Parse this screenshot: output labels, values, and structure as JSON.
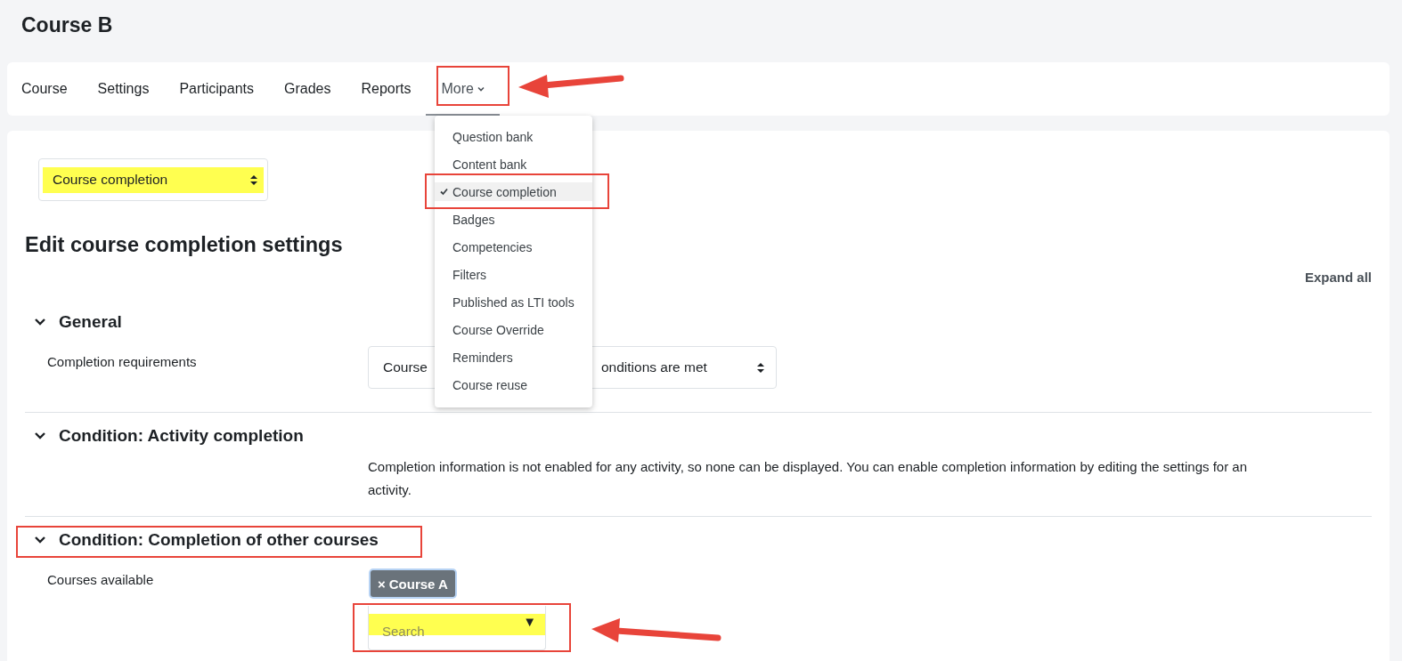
{
  "course_title": "Course B",
  "nav": {
    "tabs": [
      {
        "label": "Course",
        "selected": false
      },
      {
        "label": "Settings",
        "selected": false
      },
      {
        "label": "Participants",
        "selected": false
      },
      {
        "label": "Grades",
        "selected": false
      },
      {
        "label": "Reports",
        "selected": false
      },
      {
        "label": "More",
        "selected": true
      }
    ]
  },
  "more_menu": {
    "expanded": true,
    "items": [
      {
        "label": "Question bank",
        "selected": false
      },
      {
        "label": "Content bank",
        "selected": false
      },
      {
        "label": "Course completion",
        "selected": true
      },
      {
        "label": "Badges",
        "selected": false
      },
      {
        "label": "Competencies",
        "selected": false
      },
      {
        "label": "Filters",
        "selected": false
      },
      {
        "label": "Published as LTI tools",
        "selected": false
      },
      {
        "label": "Course Override",
        "selected": false
      },
      {
        "label": "Reminders",
        "selected": false
      },
      {
        "label": "Course reuse",
        "selected": false
      }
    ]
  },
  "page_select": {
    "value": "Course completion"
  },
  "heading": "Edit course completion settings",
  "expand_all": "Expand all",
  "sections": [
    {
      "kind": "select",
      "title": "General",
      "expanded": true,
      "label": "Completion requirements",
      "value_parts": [
        "Course",
        "onditions are met"
      ]
    },
    {
      "kind": "text",
      "title": "Condition: Activity completion",
      "expanded": true,
      "text": "Completion information is not enabled for any activity, so none can be displayed. You can enable completion information by editing the settings for an activity."
    },
    {
      "kind": "courses",
      "title": "Condition: Completion of other courses",
      "expanded": true,
      "label": "Courses available",
      "tags": [
        {
          "remove": "×",
          "label": "Course A"
        }
      ],
      "search": {
        "placeholder": "Search",
        "toggle": "▼"
      }
    }
  ]
}
